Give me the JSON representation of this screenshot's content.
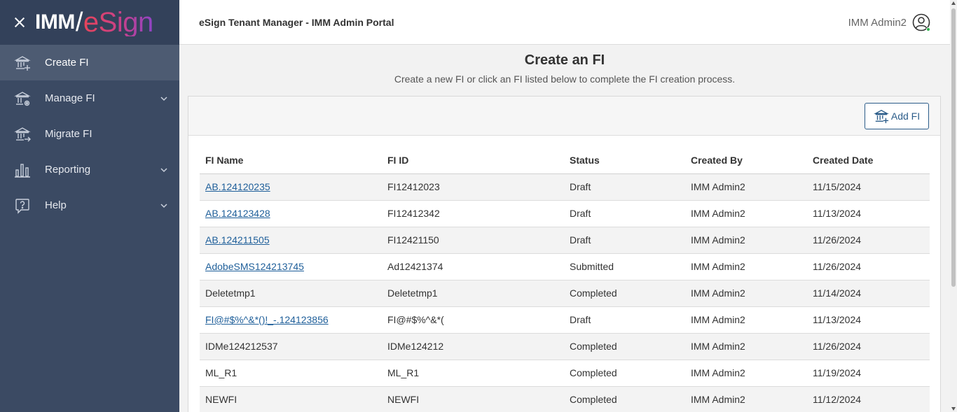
{
  "brand": {
    "logo_imm": "IMM",
    "logo_slash": "/",
    "logo_esign": "eSign"
  },
  "header": {
    "app_title": "eSign Tenant Manager - IMM Admin Portal",
    "user_name": "IMM Admin2"
  },
  "sidebar": {
    "items": [
      {
        "label": "Create FI",
        "icon": "bank-add-icon",
        "active": true,
        "expandable": false
      },
      {
        "label": "Manage FI",
        "icon": "bank-gear-icon",
        "active": false,
        "expandable": true
      },
      {
        "label": "Migrate FI",
        "icon": "bank-arrow-icon",
        "active": false,
        "expandable": false
      },
      {
        "label": "Reporting",
        "icon": "bar-chart-icon",
        "active": false,
        "expandable": true
      },
      {
        "label": "Help",
        "icon": "help-icon",
        "active": false,
        "expandable": true
      }
    ]
  },
  "main": {
    "title": "Create an FI",
    "subtitle": "Create a new FI or click an FI listed below to complete the FI creation process.",
    "add_button_label": "Add FI",
    "table": {
      "columns": [
        "FI Name",
        "FI ID",
        "Status",
        "Created By",
        "Created Date"
      ],
      "rows": [
        {
          "name": "AB.124120235",
          "id": "FI12412023",
          "status": "Draft",
          "created_by": "IMM Admin2",
          "date": "11/15/2024",
          "link": true
        },
        {
          "name": "AB.124123428",
          "id": "FI12412342",
          "status": "Draft",
          "created_by": "IMM Admin2",
          "date": "11/13/2024",
          "link": true
        },
        {
          "name": "AB.124211505",
          "id": "FI12421150",
          "status": "Draft",
          "created_by": "IMM Admin2",
          "date": "11/26/2024",
          "link": true
        },
        {
          "name": "AdobeSMS124213745",
          "id": "Ad12421374",
          "status": "Submitted",
          "created_by": "IMM Admin2",
          "date": "11/26/2024",
          "link": true
        },
        {
          "name": "Deletetmp1",
          "id": "Deletetmp1",
          "status": "Completed",
          "created_by": "IMM Admin2",
          "date": "11/14/2024",
          "link": false
        },
        {
          "name": "FI@#$%^&*()!_-.124123856",
          "id": "FI@#$%^&*(",
          "status": "Draft",
          "created_by": "IMM Admin2",
          "date": "11/13/2024",
          "link": true
        },
        {
          "name": "IDMe124212537",
          "id": "IDMe124212",
          "status": "Completed",
          "created_by": "IMM Admin2",
          "date": "11/26/2024",
          "link": false
        },
        {
          "name": "ML_R1",
          "id": "ML_R1",
          "status": "Completed",
          "created_by": "IMM Admin2",
          "date": "11/19/2024",
          "link": false
        },
        {
          "name": "NEWFI",
          "id": "NEWFI",
          "status": "Completed",
          "created_by": "IMM Admin2",
          "date": "11/12/2024",
          "link": false
        }
      ]
    }
  },
  "colors": {
    "sidebar_bg": "#3b4a63",
    "sidebar_active": "#4d5b72",
    "link": "#1f5f9a",
    "accent_button": "#2c5d8a"
  }
}
